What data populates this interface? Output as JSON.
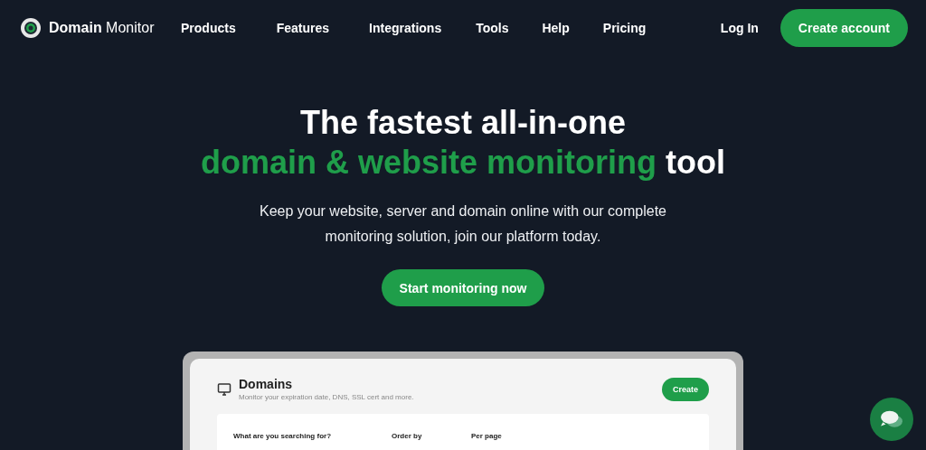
{
  "nav": {
    "brand": "**Domain** Monitor",
    "links": [
      "Products",
      "Features",
      "Integrations",
      "Tools",
      "Help",
      "Pricing"
    ],
    "login": "Log In",
    "cta": "Create account"
  },
  "hero": {
    "title_line_1": "The fastest all-in-one",
    "title_highlight": "domain & website monitoring",
    "title_rest": "tool",
    "subtitle": "Keep your website, server and domain online with our complete monitoring solution, join our platform today.",
    "cta": "Start monitoring now"
  },
  "preview": {
    "title": "Domains",
    "subtitle": "Monitor your expiration date, DNS, SSL cert and more.",
    "create": "Create",
    "filters": [
      "What are you searching for?",
      "Order by",
      "Per page"
    ]
  }
}
